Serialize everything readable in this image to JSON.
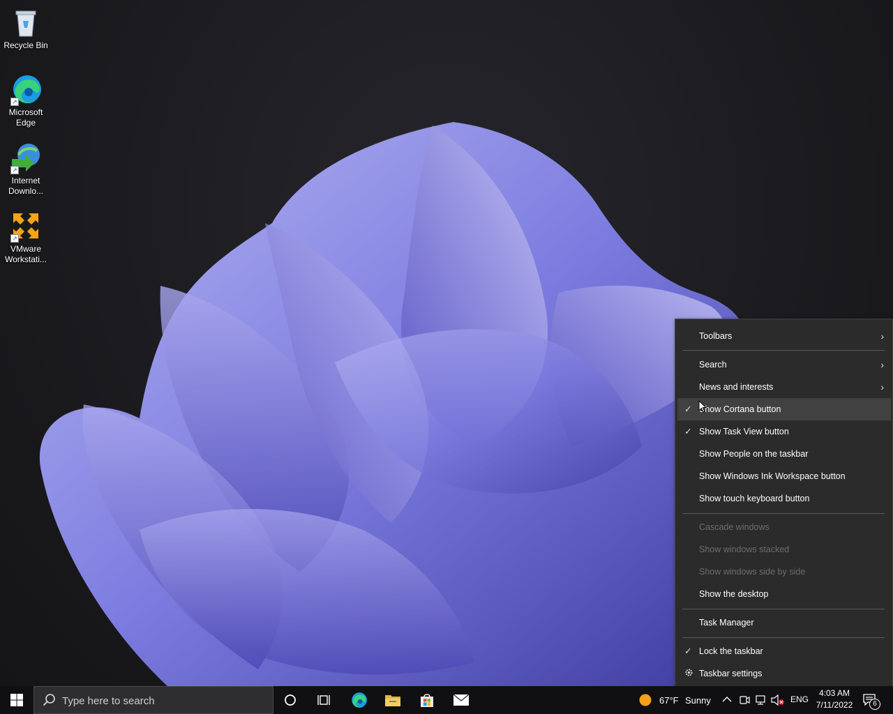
{
  "desktop": {
    "icons": [
      {
        "label": "Recycle Bin",
        "icon": "recycle-bin-icon"
      },
      {
        "label": "Microsoft Edge",
        "icon": "edge-icon"
      },
      {
        "label": "Internet Downlo...",
        "icon": "idm-icon"
      },
      {
        "label": "VMware Workstati...",
        "icon": "vmware-icon"
      }
    ]
  },
  "context_menu": {
    "toolbars": "Toolbars",
    "search": "Search",
    "news": "News and interests",
    "cortana": "Show Cortana button",
    "cortana_checked": true,
    "taskview": "Show Task View button",
    "taskview_checked": true,
    "people": "Show People on the taskbar",
    "ink": "Show Windows Ink Workspace button",
    "keyboard": "Show touch keyboard button",
    "cascade": "Cascade windows",
    "stacked": "Show windows stacked",
    "sidebyside": "Show windows side by side",
    "desktop": "Show the desktop",
    "taskmgr": "Task Manager",
    "lock": "Lock the taskbar",
    "lock_checked": true,
    "settings": "Taskbar settings",
    "check_glyph": "✓",
    "arrow_glyph": "›"
  },
  "taskbar": {
    "search_placeholder": "Type here to search",
    "weather_temp": "67°F",
    "weather_desc": "Sunny",
    "language": "ENG",
    "time": "4:03 AM",
    "date": "7/11/2022",
    "notification_count": "6",
    "pinned": [
      "cortana-icon",
      "task-view-icon",
      "edge-icon",
      "file-explorer-icon",
      "store-icon",
      "mail-icon"
    ]
  },
  "colors": {
    "menu_bg": "#2b2b2b",
    "taskbar_bg": "#101013",
    "wallpaper_accent": "#6b6cd8"
  }
}
